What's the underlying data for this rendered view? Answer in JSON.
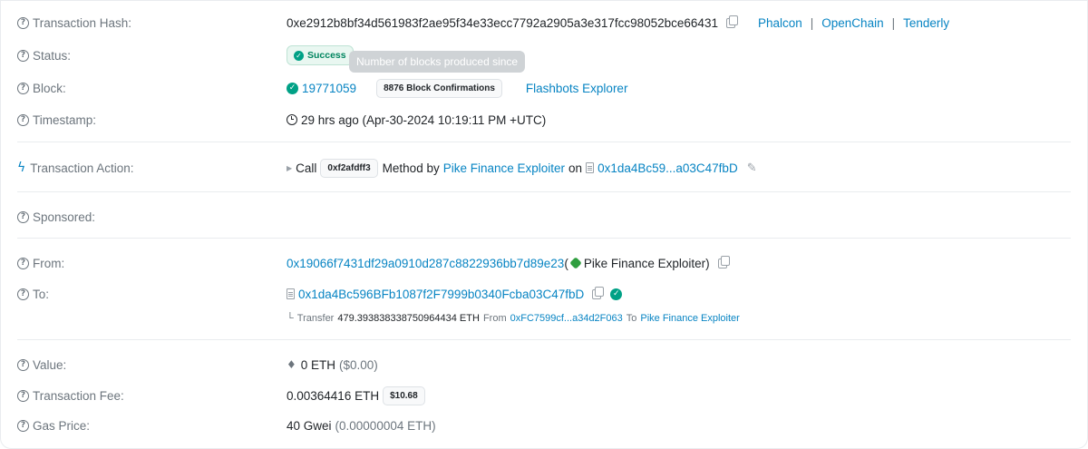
{
  "hash": {
    "label": "Transaction Hash:",
    "value": "0xe2912b8bf34d561983f2ae95f34e33ecc7792a2905a3e317fcc98052bce66431",
    "explorers": [
      "Phalcon",
      "OpenChain",
      "Tenderly"
    ],
    "separator": "|"
  },
  "status": {
    "label": "Status:",
    "value": "Success"
  },
  "tooltip": "Number of blocks produced since",
  "block": {
    "label": "Block:",
    "number": "19771059",
    "confirmations": "8876 Block Confirmations",
    "explorer": "Flashbots Explorer"
  },
  "timestamp": {
    "label": "Timestamp:",
    "value": "29 hrs ago (Apr-30-2024 10:19:11 PM +UTC)"
  },
  "action": {
    "label": "Transaction Action:",
    "call": "Call",
    "method_id": "0xf2afdff3",
    "method_by": "Method by",
    "caller": "Pike Finance Exploiter",
    "on": "on",
    "contract": "0x1da4Bc59...a03C47fbD"
  },
  "sponsored": {
    "label": "Sponsored:"
  },
  "from": {
    "label": "From:",
    "address": "0x19066f7431df29a0910d287c8822936bb7d89e23",
    "name_open": "(",
    "name": "Pike Finance Exploiter",
    "name_close": ")"
  },
  "to": {
    "label": "To:",
    "address": "0x1da4Bc596BFb1087f2F7999b0340Fcba03C47fbD",
    "transfer": {
      "prefix": "Transfer",
      "amount": "479.393838338750964434 ETH",
      "from_label": "From",
      "from": "0xFC7599cf...a34d2F063",
      "to_label": "To",
      "to": "Pike Finance Exploiter"
    }
  },
  "value": {
    "label": "Value:",
    "amount": "0 ETH",
    "usd": "($0.00)"
  },
  "fee": {
    "label": "Transaction Fee:",
    "amount": "0.00364416 ETH",
    "usd": "$10.68"
  },
  "gas": {
    "label": "Gas Price:",
    "amount": "40 Gwei",
    "eth": "(0.00000004 ETH)"
  },
  "icons": {
    "help": "question-circle-icon",
    "bolt": "lightning-icon",
    "copy": "copy-icon",
    "check": "check-circle-icon",
    "clock": "clock-icon",
    "contract": "contract-document-icon",
    "pencil": "edit-icon",
    "eth": "ethereum-icon"
  },
  "colors": {
    "link": "#0784c3",
    "muted": "#6c757d",
    "success": "#00a186",
    "border": "#e9ecef"
  }
}
